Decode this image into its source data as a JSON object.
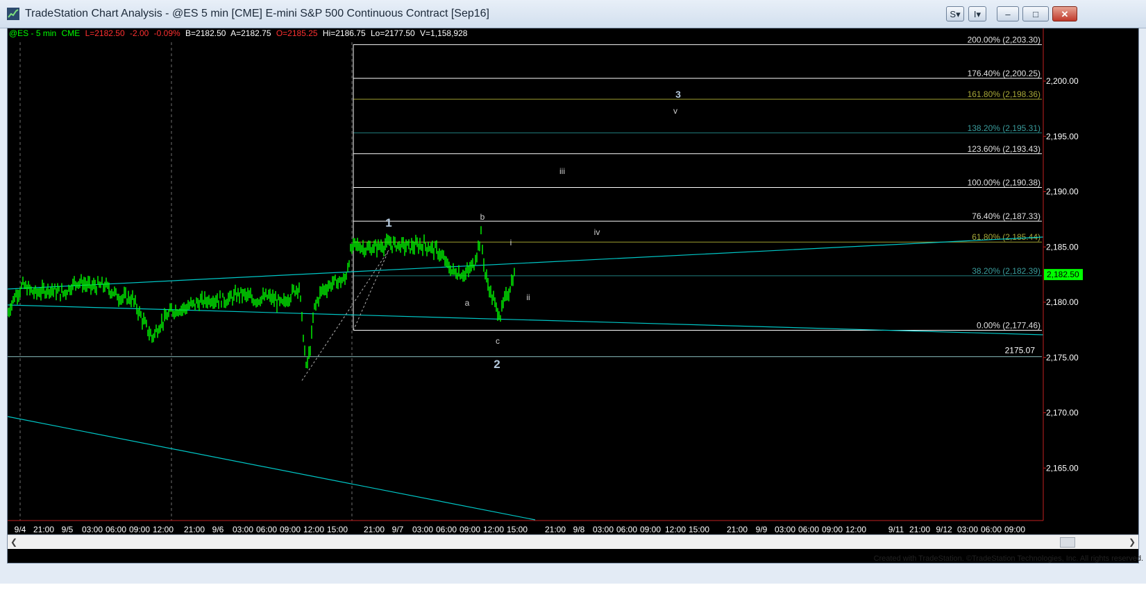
{
  "window": {
    "title": "TradeStation Chart Analysis - @ES 5 min [CME] E-mini S&P 500 Continuous Contract [Sep16]",
    "buttons": {
      "s_menu": "S",
      "i_menu": "I",
      "minimize": "–",
      "maximize": "□",
      "close": "✕"
    }
  },
  "symbol_bar": {
    "symbol": "@ES - 5 min",
    "exchange": "CME",
    "last": "L=2182.50",
    "change": "-2.00",
    "change_pct": "-0.09%",
    "bid": "B=2182.50",
    "ask": "A=2182.75",
    "open": "O=2185.25",
    "high": "Hi=2186.75",
    "low": "Lo=2177.50",
    "volume": "V=1,158,928"
  },
  "colors": {
    "price_bars": "#00ff00",
    "trendline": "#00c8c8",
    "fib_white": "#ffffff",
    "fib_teal": "#208080",
    "fib_olive": "#a0a030",
    "label_white": "#e0e0e0",
    "label_teal": "#3a9c9c",
    "label_olive": "#a8a838",
    "price_axis_highlight": "#00ff00",
    "session_divider": "#707070",
    "wave_label": "#b4c8dc"
  },
  "fib_levels": [
    {
      "label": "200.00% (2,203.30)",
      "price": 2203.3,
      "color": "white"
    },
    {
      "label": "176.40% (2,200.25)",
      "price": 2200.25,
      "color": "white"
    },
    {
      "label": "161.80% (2,198.36)",
      "price": 2198.36,
      "color": "olive"
    },
    {
      "label": "138.20% (2,195.31)",
      "price": 2195.31,
      "color": "teal"
    },
    {
      "label": "123.60% (2,193.43)",
      "price": 2193.43,
      "color": "white"
    },
    {
      "label": "100.00% (2,190.38)",
      "price": 2190.38,
      "color": "white"
    },
    {
      "label": "76.40% (2,187.33)",
      "price": 2187.33,
      "color": "white"
    },
    {
      "label": "61.80% (2,185.44)",
      "price": 2185.44,
      "color": "olive"
    },
    {
      "label": "38.20% (2,182.39)",
      "price": 2182.39,
      "color": "teal"
    },
    {
      "label": "0.00% (2,177.46)",
      "price": 2177.46,
      "color": "white"
    }
  ],
  "support_line": {
    "label": "2175.07",
    "price": 2175.07
  },
  "wave_labels": {
    "w1": "1",
    "w2": "2",
    "w3": "3",
    "a": "a",
    "b": "b",
    "c": "c",
    "i": "i",
    "ii": "ii",
    "iii": "iii",
    "iv": "iv",
    "v": "v"
  },
  "price_axis": {
    "ticks": [
      "2,200.00",
      "2,195.00",
      "2,190.00",
      "2,185.00",
      "2,180.00",
      "2,175.00",
      "2,170.00",
      "2,165.00"
    ],
    "tick_values": [
      2200,
      2195,
      2190,
      2185,
      2180,
      2175,
      2170,
      2165
    ],
    "current_price": "2,182.50",
    "current_value": 2182.5
  },
  "time_axis": {
    "labels": [
      "9/4",
      "21:00",
      "9/5",
      "03:00",
      "06:00",
      "09:00",
      "12:00",
      "21:00",
      "9/6",
      "03:00",
      "06:00",
      "09:00",
      "12:00",
      "15:00",
      "21:00",
      "9/7",
      "03:00",
      "06:00",
      "09:00",
      "12:00",
      "15:00",
      "21:00",
      "9/8",
      "03:00",
      "06:00",
      "09:00",
      "12:00",
      "15:00",
      "21:00",
      "9/9",
      "03:00",
      "06:00",
      "09:00",
      "12:00",
      "9/11",
      "21:00",
      "9/12",
      "03:00",
      "06:00",
      "09:00"
    ]
  },
  "footer": "Created with TradeStation. ©TradeStation Technologies, Inc. All rights reserved."
}
